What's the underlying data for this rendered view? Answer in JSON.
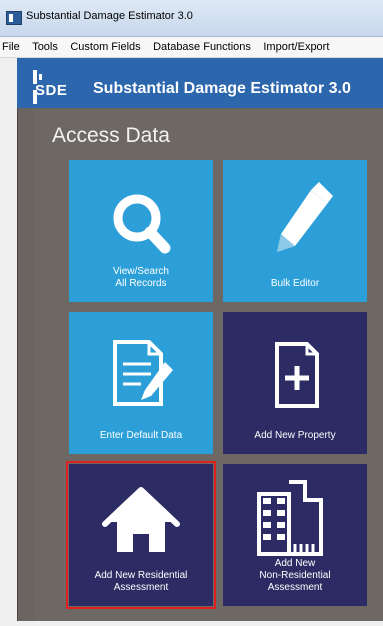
{
  "window": {
    "title": "Substantial Damage Estimator 3.0"
  },
  "menu": {
    "items": [
      "File",
      "Tools",
      "Custom Fields",
      "Database Functions",
      "Import/Export"
    ]
  },
  "header": {
    "logo_text": "SDE",
    "app_title": "Substantial Damage Estimator 3.0"
  },
  "main": {
    "section_title": "Access Data",
    "tiles": [
      {
        "label": "View/Search\nAll Records",
        "icon": "search-icon",
        "style": "light"
      },
      {
        "label": "Bulk Editor",
        "icon": "pencil-icon",
        "style": "light"
      },
      {
        "label": "Enter Default Data",
        "icon": "document-edit-icon",
        "style": "light"
      },
      {
        "label": "Add New Property",
        "icon": "document-add-icon",
        "style": "dark"
      },
      {
        "label": "Add New Residential\nAssessment",
        "icon": "house-icon",
        "style": "dark",
        "selected": true
      },
      {
        "label": "Add New\nNon-Residential\nAssessment",
        "icon": "building-icon",
        "style": "dark"
      }
    ]
  },
  "colors": {
    "header_blue": "#2c66ad",
    "tile_light": "#2d9fd8",
    "tile_dark": "#2c2b63",
    "content_bg": "#6e6864",
    "selection": "#e0201f"
  }
}
